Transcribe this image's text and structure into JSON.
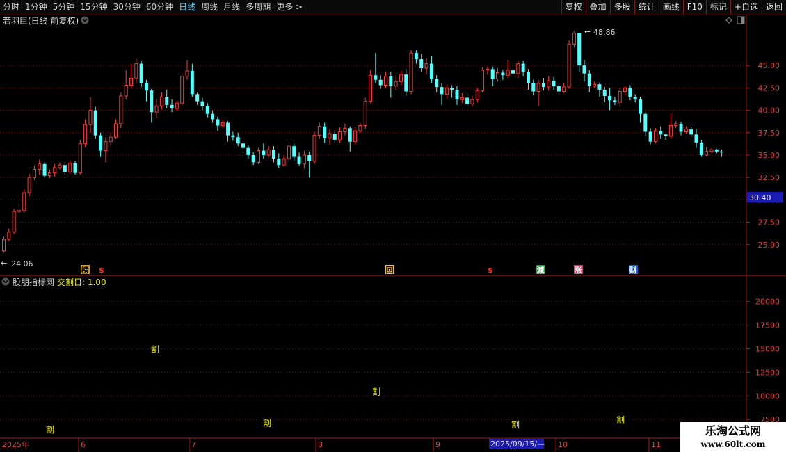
{
  "toolbar": {
    "periods": [
      "分时",
      "1分钟",
      "5分钟",
      "15分钟",
      "30分钟",
      "60分钟",
      "日线",
      "周线",
      "月线",
      "多周期",
      "更多 >"
    ],
    "active_period": "日线",
    "actions": [
      "复权",
      "叠加",
      "多股",
      "统计",
      "画线",
      "F10",
      "标记",
      "+自选",
      "返回"
    ]
  },
  "main_panel": {
    "title": "若羽臣(日线 前复权)",
    "high_label": "48.86",
    "low_label": "24.06",
    "current_price_tag": "30.40",
    "price_axis": [
      "45.00",
      "42.50",
      "40.00",
      "37.50",
      "35.00",
      "32.50",
      "30.00",
      "27.50",
      "25.00"
    ],
    "event_markers": [
      {
        "text": "榜",
        "bg": "#d8a000",
        "color": "#000"
      },
      {
        "text": "$",
        "bg": "",
        "color": "#ff3030"
      },
      {
        "text": "回",
        "bg": "#f0c060",
        "color": "#000"
      },
      {
        "text": "$",
        "bg": "",
        "color": "#ff3030"
      },
      {
        "text": "減",
        "bg": "#20a040",
        "color": "#fff"
      },
      {
        "text": "涨",
        "bg": "#e83060",
        "color": "#fff"
      },
      {
        "text": "财",
        "bg": "#1e5cc8",
        "color": "#fff"
      }
    ]
  },
  "sub_panel": {
    "title": "股朋指标网",
    "indicator": "交割日: 1.00",
    "value_axis": [
      "20000",
      "17500",
      "15000",
      "12500",
      "10000",
      "7500"
    ],
    "marker_text": "割"
  },
  "date_axis": {
    "labels": [
      "2025年",
      "6",
      "7",
      "8",
      "9",
      "10",
      "11"
    ],
    "cursor_date": "2025/09/15/—"
  },
  "chart_data": {
    "type": "candlestick",
    "price_range": [
      23.2,
      50.6
    ],
    "colors": {
      "up": "#ff3b3b",
      "down": "#54ffff"
    },
    "candles": [
      [
        24.3,
        25.6,
        24.1,
        25.9
      ],
      [
        25.6,
        26.4,
        25.4,
        26.8
      ],
      [
        26.4,
        28.7,
        26.2,
        29.0
      ],
      [
        28.7,
        28.8,
        28.2,
        29.6
      ],
      [
        28.8,
        30.8,
        28.6,
        31.2
      ],
      [
        30.8,
        32.5,
        30.4,
        32.9
      ],
      [
        32.5,
        33.4,
        32.2,
        33.8
      ],
      [
        33.4,
        34.0,
        32.8,
        34.5
      ],
      [
        34.0,
        32.7,
        32.5,
        34.2
      ],
      [
        32.7,
        33.0,
        32.4,
        33.4
      ],
      [
        33.0,
        33.6,
        32.6,
        34.0
      ],
      [
        33.6,
        33.9,
        33.4,
        34.2
      ],
      [
        33.9,
        33.1,
        32.8,
        34.2
      ],
      [
        33.1,
        34.1,
        32.9,
        34.4
      ],
      [
        34.1,
        33.0,
        32.8,
        34.3
      ],
      [
        33.0,
        36.3,
        32.8,
        36.7
      ],
      [
        36.3,
        38.4,
        35.9,
        39.0
      ],
      [
        38.4,
        40.0,
        37.5,
        41.5
      ],
      [
        40.0,
        37.2,
        36.8,
        40.4
      ],
      [
        37.2,
        35.5,
        34.8,
        37.5
      ],
      [
        35.5,
        36.5,
        34.2,
        37.0
      ],
      [
        36.5,
        37.0,
        36.0,
        37.5
      ],
      [
        37.0,
        38.5,
        36.8,
        39.0
      ],
      [
        38.5,
        41.6,
        38.0,
        42.0
      ],
      [
        41.6,
        42.8,
        41.2,
        44.5
      ],
      [
        42.8,
        43.6,
        42.4,
        45.2
      ],
      [
        43.6,
        45.2,
        43.0,
        45.8
      ],
      [
        45.2,
        43.0,
        42.6,
        45.5
      ],
      [
        43.0,
        42.2,
        41.0,
        43.4
      ],
      [
        42.2,
        39.8,
        38.6,
        42.4
      ],
      [
        39.8,
        40.5,
        39.2,
        41.2
      ],
      [
        40.5,
        41.5,
        40.1,
        42.0
      ],
      [
        41.5,
        40.6,
        40.2,
        42.3
      ],
      [
        40.6,
        40.2,
        39.8,
        41.2
      ],
      [
        40.2,
        40.8,
        39.9,
        41.1
      ],
      [
        40.8,
        43.8,
        40.5,
        44.2
      ],
      [
        43.8,
        44.4,
        43.4,
        45.6
      ],
      [
        44.4,
        41.8,
        41.5,
        45.2
      ],
      [
        41.8,
        41.0,
        40.6,
        42.0
      ],
      [
        41.0,
        40.5,
        40.0,
        41.4
      ],
      [
        40.5,
        39.6,
        39.2,
        40.8
      ],
      [
        39.6,
        39.0,
        38.6,
        40.0
      ],
      [
        39.0,
        38.3,
        37.7,
        39.3
      ],
      [
        38.3,
        38.6,
        38.0,
        39.0
      ],
      [
        38.6,
        37.2,
        36.5,
        38.8
      ],
      [
        37.2,
        37.0,
        36.6,
        37.6
      ],
      [
        37.0,
        36.3,
        36.0,
        37.5
      ],
      [
        36.3,
        35.8,
        35.2,
        36.6
      ],
      [
        35.8,
        35.0,
        34.6,
        36.1
      ],
      [
        35.0,
        34.2,
        33.9,
        35.3
      ],
      [
        34.2,
        35.5,
        34.0,
        35.8
      ],
      [
        35.5,
        35.0,
        34.6,
        36.3
      ],
      [
        35.0,
        35.6,
        34.8,
        36.0
      ],
      [
        35.6,
        34.6,
        34.2,
        36.0
      ],
      [
        34.6,
        33.9,
        33.6,
        35.2
      ],
      [
        33.9,
        34.6,
        33.7,
        35.0
      ],
      [
        34.6,
        36.0,
        34.2,
        36.5
      ],
      [
        36.0,
        34.8,
        34.3,
        36.3
      ],
      [
        34.8,
        34.0,
        33.8,
        35.3
      ],
      [
        34.0,
        35.0,
        33.5,
        35.5
      ],
      [
        35.0,
        34.3,
        32.5,
        35.4
      ],
      [
        34.3,
        37.2,
        34.0,
        37.6
      ],
      [
        37.2,
        38.2,
        36.8,
        38.6
      ],
      [
        38.2,
        36.9,
        36.4,
        38.6
      ],
      [
        36.9,
        37.4,
        36.2,
        37.9
      ],
      [
        37.4,
        36.7,
        36.3,
        37.8
      ],
      [
        36.7,
        37.6,
        36.4,
        38.1
      ],
      [
        37.6,
        38.0,
        37.2,
        38.5
      ],
      [
        38.0,
        36.5,
        35.4,
        38.2
      ],
      [
        36.5,
        37.7,
        36.2,
        38.1
      ],
      [
        37.7,
        38.3,
        37.5,
        38.6
      ],
      [
        38.3,
        41.0,
        37.9,
        41.4
      ],
      [
        41.0,
        43.9,
        40.8,
        44.5
      ],
      [
        43.9,
        43.4,
        43.0,
        46.4
      ],
      [
        43.4,
        42.8,
        42.4,
        43.9
      ],
      [
        42.8,
        43.8,
        42.5,
        44.3
      ],
      [
        43.8,
        42.7,
        41.4,
        44.3
      ],
      [
        42.7,
        43.2,
        42.3,
        43.9
      ],
      [
        43.2,
        44.0,
        42.8,
        44.4
      ],
      [
        44.0,
        42.1,
        41.6,
        44.6
      ],
      [
        42.1,
        46.4,
        41.8,
        46.7
      ],
      [
        46.4,
        45.7,
        45.2,
        46.7
      ],
      [
        45.7,
        44.7,
        44.3,
        46.3
      ],
      [
        44.7,
        45.2,
        44.0,
        45.8
      ],
      [
        45.2,
        43.5,
        43.0,
        46.1
      ],
      [
        43.5,
        42.6,
        42.0,
        43.9
      ],
      [
        42.6,
        41.8,
        40.6,
        43.0
      ],
      [
        41.8,
        42.5,
        41.3,
        42.9
      ],
      [
        42.5,
        42.3,
        41.4,
        42.8
      ],
      [
        42.3,
        41.2,
        40.6,
        42.7
      ],
      [
        41.2,
        41.4,
        40.8,
        41.9
      ],
      [
        41.4,
        40.7,
        40.4,
        41.9
      ],
      [
        40.7,
        41.2,
        40.4,
        41.6
      ],
      [
        41.2,
        42.2,
        40.9,
        42.5
      ],
      [
        42.2,
        44.5,
        42.0,
        44.8
      ],
      [
        44.5,
        44.6,
        44.0,
        44.9
      ],
      [
        44.6,
        43.5,
        42.7,
        44.9
      ],
      [
        43.5,
        44.2,
        43.2,
        44.7
      ],
      [
        44.2,
        43.9,
        43.4,
        44.5
      ],
      [
        43.9,
        44.5,
        43.6,
        45.6
      ],
      [
        44.5,
        44.1,
        43.6,
        45.3
      ],
      [
        44.1,
        45.2,
        43.6,
        45.5
      ],
      [
        45.2,
        44.3,
        43.8,
        45.5
      ],
      [
        44.3,
        43.0,
        42.3,
        44.6
      ],
      [
        43.0,
        42.1,
        41.7,
        43.4
      ],
      [
        42.1,
        43.0,
        40.5,
        43.4
      ],
      [
        43.0,
        42.6,
        42.2,
        43.6
      ],
      [
        42.6,
        43.3,
        42.2,
        43.8
      ],
      [
        43.3,
        42.7,
        42.3,
        43.7
      ],
      [
        42.7,
        42.1,
        41.8,
        43.0
      ],
      [
        42.1,
        42.6,
        41.9,
        43.0
      ],
      [
        42.6,
        47.4,
        42.4,
        47.8
      ],
      [
        47.4,
        48.6,
        47.0,
        48.86
      ],
      [
        48.6,
        45.0,
        44.3,
        48.6
      ],
      [
        45.0,
        44.1,
        43.2,
        45.6
      ],
      [
        44.1,
        42.7,
        42.0,
        44.5
      ],
      [
        42.7,
        42.9,
        42.5,
        43.2
      ],
      [
        42.9,
        42.3,
        41.5,
        43.1
      ],
      [
        42.3,
        41.6,
        40.9,
        42.6
      ],
      [
        41.6,
        41.1,
        40.0,
        42.5
      ],
      [
        41.1,
        40.9,
        40.6,
        41.5
      ],
      [
        40.9,
        42.1,
        40.4,
        42.5
      ],
      [
        42.1,
        42.5,
        41.7,
        42.7
      ],
      [
        42.5,
        41.5,
        41.1,
        42.8
      ],
      [
        41.5,
        41.2,
        40.9,
        41.8
      ],
      [
        41.2,
        39.6,
        38.6,
        41.5
      ],
      [
        39.6,
        37.6,
        37.1,
        39.8
      ],
      [
        37.6,
        36.5,
        36.2,
        38.0
      ],
      [
        36.5,
        37.7,
        36.3,
        38.0
      ],
      [
        37.7,
        37.3,
        36.8,
        38.2
      ],
      [
        37.3,
        37.1,
        36.7,
        37.4
      ],
      [
        37.1,
        38.3,
        36.8,
        39.7
      ],
      [
        38.3,
        38.5,
        38.0,
        38.8
      ],
      [
        38.5,
        37.6,
        37.2,
        38.7
      ],
      [
        37.6,
        37.9,
        37.4,
        38.2
      ],
      [
        37.9,
        37.3,
        37.0,
        38.1
      ],
      [
        37.3,
        36.4,
        35.8,
        37.9
      ],
      [
        36.4,
        35.0,
        34.8,
        36.7
      ],
      [
        35.0,
        35.4,
        34.9,
        35.9
      ],
      [
        35.4,
        35.6,
        35.3,
        35.8
      ],
      [
        35.6,
        35.4,
        35.2,
        35.7
      ],
      [
        35.4,
        35.3,
        34.8,
        35.6
      ]
    ],
    "sub_markers_y": [
      6500,
      15000,
      7200,
      10500,
      7000,
      7500
    ],
    "sub_range": [
      5600,
      22700
    ]
  }
}
